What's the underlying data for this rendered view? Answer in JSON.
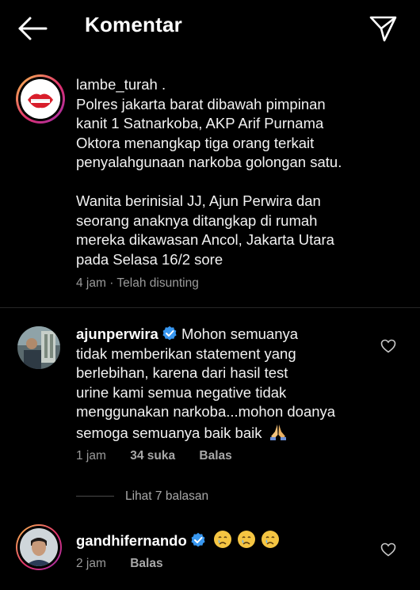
{
  "header": {
    "title": "Komentar",
    "back_icon": "arrow-left-icon",
    "share_icon": "paper-plane-icon"
  },
  "caption": {
    "username": "lambe_turah",
    "suffix": ".",
    "lines_p1": [
      "Polres jakarta barat dibawah pimpinan",
      "kanit 1 Satnarkoba, AKP Arif Purnama",
      "Oktora menangkap tiga orang terkait",
      "penyalahgunaan narkoba golongan satu."
    ],
    "lines_p2": [
      "Wanita berinisial JJ, Ajun Perwira dan",
      "seorang anaknya ditangkap di rumah",
      "mereka dikawasan Ancol, Jakarta Utara",
      "pada Selasa 16/2 sore"
    ],
    "time": "4 jam",
    "edited": "· Telah disunting"
  },
  "comments": [
    {
      "username": "ajunperwira",
      "lines": [
        "Mohon semuanya",
        "tidak memberikan statement yang",
        "berlebihan, karena dari hasil test",
        "urine kami semua negative tidak",
        "menggunakan narkoba...mohon doanya",
        "semoga semuanya baik baik"
      ],
      "time": "1 jam",
      "likes": "34 suka",
      "reply": "Balas",
      "view_replies": "Lihat 7 balasan"
    },
    {
      "username": "gandhifernando",
      "time": "2 jam",
      "reply": "Balas"
    }
  ],
  "colors": {
    "background": "#000000",
    "verified": "#3897f0",
    "muted": "#9a9a9a"
  }
}
